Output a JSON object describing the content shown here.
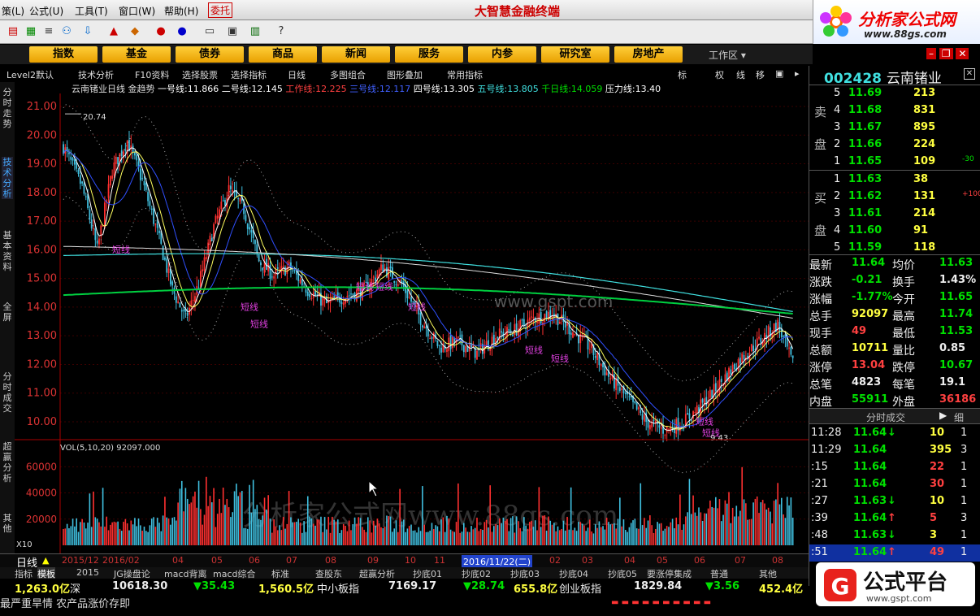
{
  "menu": [
    "策(L)",
    "公式(U)",
    "工具(T)",
    "窗口(W)",
    "帮助(H)",
    "委托"
  ],
  "app_title": "大智慧金融终端",
  "logo": {
    "text": "分析家公式网",
    "url": "www.88gs.com"
  },
  "nav": [
    "指数",
    "基金",
    "债券",
    "商品",
    "新闻",
    "服务",
    "内参",
    "研究室",
    "房地产"
  ],
  "workspace": "工作区",
  "subtoolbar": [
    "Level2默认",
    "技术分析",
    "F10资料",
    "选择股票",
    "选择指标",
    "日线",
    "多图组合",
    "图形叠加",
    "常用指标",
    "标",
    "权",
    "线",
    "移"
  ],
  "left_tabs": [
    "分时走势",
    "技术分析",
    "基本资料",
    "全屏",
    "分时成交",
    "超赢分析",
    "其他"
  ],
  "chart_header": {
    "name": "云南锗业日线",
    "indicator": "金趋势",
    "lines": [
      {
        "label": "一号线:",
        "value": "11.866",
        "color": "#ffffff"
      },
      {
        "label": "二号线:",
        "value": "12.145",
        "color": "#ffffff"
      },
      {
        "label": "工作线:",
        "value": "12.225",
        "color": "#ff4040"
      },
      {
        "label": "三号线:",
        "value": "12.117",
        "color": "#4060ff"
      },
      {
        "label": "四号线:",
        "value": "13.305",
        "color": "#ffffff"
      },
      {
        "label": "五号线:",
        "value": "13.805",
        "color": "#40e0e0"
      },
      {
        "label": "千日线:",
        "value": "14.059",
        "color": "#00e000"
      },
      {
        "label": "压力线:",
        "value": "13.40",
        "color": "#ffffff"
      }
    ]
  },
  "price_axis": [
    "21.00",
    "20.00",
    "19.00",
    "18.00",
    "17.00",
    "16.00",
    "15.00",
    "14.00",
    "13.00",
    "12.00",
    "11.00",
    "10.00"
  ],
  "price_annotations": {
    "high": "20.74",
    "low": "9.43"
  },
  "signal_label": "短线",
  "watermark_site": "www.gspt.com",
  "watermark_main": "分析家公式网www.88gs.com",
  "vol_header": "VOL(5,10,20)  92097.000",
  "vol_axis": [
    "60000",
    "40000",
    "20000"
  ],
  "vol_unit": "X10",
  "date_axis": [
    "2015/12",
    "2016/02",
    "04",
    "05",
    "06",
    "07",
    "08",
    "09",
    "10",
    "11",
    "2016/11/22(二)",
    "02",
    "03",
    "04",
    "05",
    "06",
    "07",
    "08"
  ],
  "bottom_tabs": [
    "日线",
    "指标",
    "模板",
    "2015",
    "JG操盘论",
    "macd背离",
    "macd综合",
    "标准",
    "查股东",
    "超赢分析",
    "抄底01",
    "抄底02",
    "抄底03",
    "抄底04",
    "抄底05",
    "要涨停集成",
    "普通",
    "其他"
  ],
  "indices": [
    {
      "t": "1,263.0亿",
      "c": "yellow"
    },
    {
      "t": "深",
      "c": "white"
    },
    {
      "t": "10618.30",
      "c": "white"
    },
    {
      "t": "▼35.43",
      "c": "green"
    },
    {
      "t": "1,560.5亿",
      "c": "yellow"
    },
    {
      "t": "中小板指",
      "c": "white"
    },
    {
      "t": "7169.17",
      "c": "white"
    },
    {
      "t": "▼28.74",
      "c": "green"
    },
    {
      "t": "655.8亿",
      "c": "yellow"
    },
    {
      "t": "创业板指",
      "c": "white"
    },
    {
      "t": "1829.84",
      "c": "white"
    },
    {
      "t": "▼3.56",
      "c": "green"
    },
    {
      "t": "452.4亿",
      "c": "yellow"
    }
  ],
  "ticker": "最严重旱情 农产品涨价存即",
  "stock": {
    "code": "002428",
    "name": "云南锗业"
  },
  "orderbook": {
    "sell_label": [
      "卖",
      "盘"
    ],
    "buy_label": [
      "买",
      "盘"
    ],
    "sell": [
      {
        "n": "5",
        "p": "11.69",
        "v": "213",
        "x": ""
      },
      {
        "n": "4",
        "p": "11.68",
        "v": "831",
        "x": ""
      },
      {
        "n": "3",
        "p": "11.67",
        "v": "895",
        "x": ""
      },
      {
        "n": "2",
        "p": "11.66",
        "v": "224",
        "x": ""
      },
      {
        "n": "1",
        "p": "11.65",
        "v": "109",
        "x": "-30"
      }
    ],
    "buy": [
      {
        "n": "1",
        "p": "11.63",
        "v": "38",
        "x": ""
      },
      {
        "n": "2",
        "p": "11.62",
        "v": "131",
        "x": "+100"
      },
      {
        "n": "3",
        "p": "11.61",
        "v": "214",
        "x": ""
      },
      {
        "n": "4",
        "p": "11.60",
        "v": "91",
        "x": ""
      },
      {
        "n": "5",
        "p": "11.59",
        "v": "118",
        "x": ""
      }
    ]
  },
  "stats": [
    {
      "l1": "最新",
      "v1": "11.64",
      "c1": "green",
      "l2": "均价",
      "v2": "11.63",
      "c2": "green"
    },
    {
      "l1": "涨跌",
      "v1": "-0.21",
      "c1": "green",
      "l2": "换手",
      "v2": "1.43%",
      "c2": "white"
    },
    {
      "l1": "涨幅",
      "v1": "-1.77%",
      "c1": "green",
      "l2": "今开",
      "v2": "11.65",
      "c2": "green"
    },
    {
      "l1": "总手",
      "v1": "92097",
      "c1": "yellow",
      "l2": "最高",
      "v2": "11.74",
      "c2": "green"
    },
    {
      "l1": "现手",
      "v1": "49",
      "c1": "red",
      "l2": "最低",
      "v2": "11.53",
      "c2": "green"
    },
    {
      "l1": "总额",
      "v1": "10711",
      "c1": "yellow",
      "l2": "量比",
      "v2": "0.85",
      "c2": "white"
    },
    {
      "l1": "涨停",
      "v1": "13.04",
      "c1": "red",
      "l2": "跌停",
      "v2": "10.67",
      "c2": "green"
    },
    {
      "l1": "总笔",
      "v1": "4823",
      "c1": "white",
      "l2": "每笔",
      "v2": "19.1",
      "c2": "white"
    },
    {
      "l1": "内盘",
      "v1": "55911",
      "c1": "green",
      "l2": "外盘",
      "v2": "36186",
      "c2": "red"
    }
  ],
  "trades_header": {
    "title": "分时成交",
    "detail": "细"
  },
  "trades": [
    {
      "t": "11:28",
      "p": "11.64",
      "a": "↓",
      "ac": "green",
      "v": "10",
      "vc": "yellow",
      "n": "1"
    },
    {
      "t": "11:29",
      "p": "11.64",
      "a": "",
      "ac": "green",
      "v": "395",
      "vc": "yellow",
      "n": "3"
    },
    {
      "t": ":15",
      "p": "11.64",
      "a": "",
      "ac": "green",
      "v": "22",
      "vc": "red",
      "n": "1"
    },
    {
      "t": ":21",
      "p": "11.64",
      "a": "",
      "ac": "green",
      "v": "30",
      "vc": "red",
      "n": "1"
    },
    {
      "t": ":27",
      "p": "11.63",
      "a": "↓",
      "ac": "green",
      "v": "10",
      "vc": "yellow",
      "n": "1"
    },
    {
      "t": ":39",
      "p": "11.64",
      "a": "↑",
      "ac": "red",
      "v": "5",
      "vc": "red",
      "n": "3"
    },
    {
      "t": ":48",
      "p": "11.63",
      "a": "↓",
      "ac": "green",
      "v": "3",
      "vc": "yellow",
      "n": "1"
    },
    {
      "t": ":51",
      "p": "11.64",
      "a": "↑",
      "ac": "red",
      "v": "49",
      "vc": "red",
      "n": "1"
    }
  ],
  "gspt": {
    "text": "公式平台",
    "url": "www.gspt.com"
  },
  "colors": {
    "up": "#ff3030",
    "down": "#40c0e0",
    "green_line": "#00d040",
    "panel_bg": "#000000",
    "nav_gold": "#f0b000"
  }
}
